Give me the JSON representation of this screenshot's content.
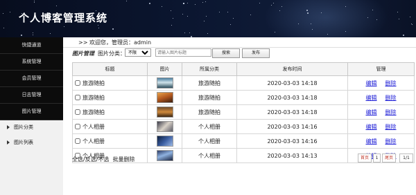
{
  "app": {
    "title": "个人博客管理系统"
  },
  "sidebar": {
    "items": [
      {
        "label": "快捷通道"
      },
      {
        "label": "系统管理"
      },
      {
        "label": "会员管理"
      },
      {
        "label": "日志管理"
      },
      {
        "label": "图片管理"
      }
    ],
    "subitems": [
      {
        "label": "图片分类"
      },
      {
        "label": "图片列表"
      }
    ]
  },
  "welcome": {
    "text": ">> 欢迎您，管理员：admin"
  },
  "toolbar": {
    "module_label": "图片管理",
    "category_label": "图片分类：",
    "category_value": "不限",
    "search_placeholder": "请输入图片标题",
    "search_label": "搜索",
    "publish_label": "发布"
  },
  "table": {
    "columns": [
      "标题",
      "图片",
      "所属分类",
      "发布时间",
      "管理"
    ],
    "rows": [
      {
        "title": "旅游随拍",
        "category": "旅游随拍",
        "time": "2020-03-03 14:18",
        "thumb": "waterfall"
      },
      {
        "title": "旅游随拍",
        "category": "旅游随拍",
        "time": "2020-03-03 14:18",
        "thumb": "sunset"
      },
      {
        "title": "旅游随拍",
        "category": "旅游随拍",
        "time": "2020-03-03 14:18",
        "thumb": "sunset-city"
      },
      {
        "title": "个人相册",
        "category": "个人相册",
        "time": "2020-03-03 14:16",
        "thumb": "portrait"
      },
      {
        "title": "个人相册",
        "category": "个人相册",
        "time": "2020-03-03 14:16",
        "thumb": "anime"
      },
      {
        "title": "个人相册",
        "category": "个人相册",
        "time": "2020-03-03 14:13",
        "thumb": "anime-blue"
      }
    ],
    "edit_label": "编辑",
    "delete_label": "删除"
  },
  "footer": {
    "select_all": "全选",
    "invert": "反选",
    "none": "不选",
    "batch_delete": "批量删除",
    "first_page": "首页",
    "current_page": "1",
    "last_page": "尾页",
    "page_total": "1/1"
  },
  "colors": {
    "header_bg": "#0b1630",
    "sidebar_bg": "#0c0c0c",
    "link": "#1a1ad6",
    "pager_accent": "#c0392b"
  }
}
